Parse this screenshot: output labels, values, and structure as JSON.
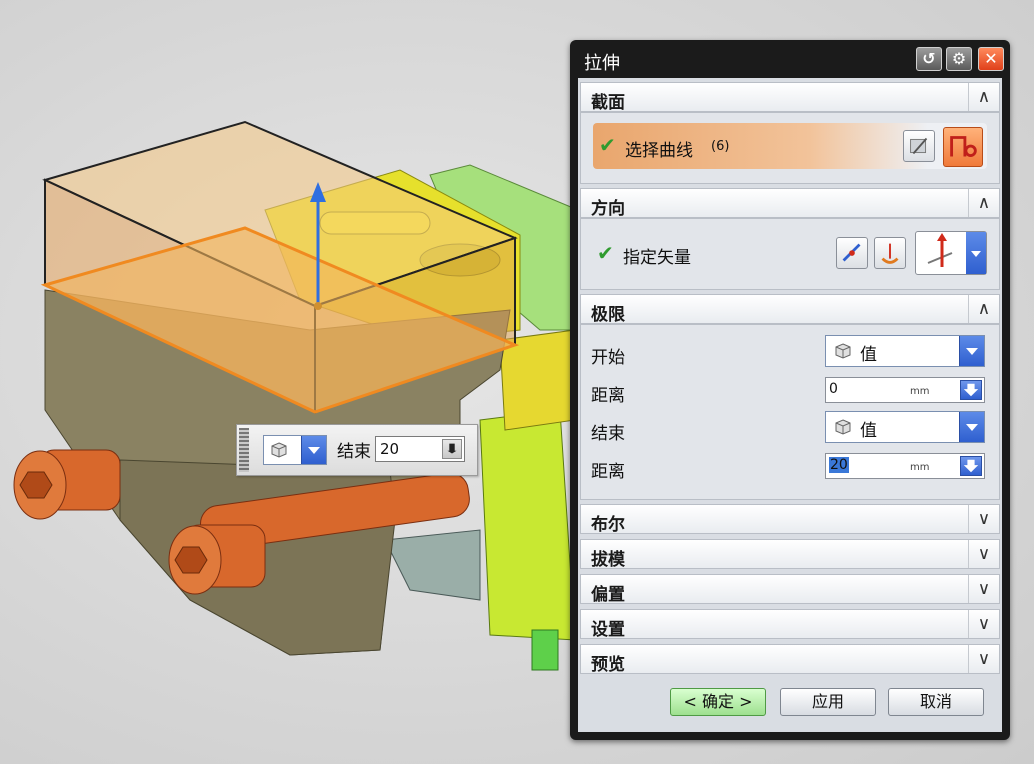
{
  "dialog": {
    "title": "拉伸",
    "titlebar_buttons": {
      "reset": "↺",
      "settings": "⚙",
      "close": "✕"
    },
    "sections": {
      "section": {
        "label": "截面",
        "select_curve": "选择曲线",
        "count": "(6)"
      },
      "direction": {
        "label": "方向",
        "specify_vector": "指定矢量"
      },
      "limits": {
        "label": "极限",
        "start_label": "开始",
        "start_value": "值",
        "start_distance_label": "距离",
        "start_distance": "0",
        "end_label": "结束",
        "end_value": "值",
        "end_distance_label": "距离",
        "end_distance": "20",
        "unit": "mm"
      },
      "boolean": {
        "label": "布尔"
      },
      "draft": {
        "label": "拔模"
      },
      "offset": {
        "label": "偏置"
      },
      "settings": {
        "label": "设置"
      },
      "preview": {
        "label": "预览"
      }
    },
    "buttons": {
      "ok": "< 确定 >",
      "apply": "应用",
      "cancel": "取消"
    }
  },
  "floating_bar": {
    "end_label": "结束",
    "end_value": "20"
  },
  "colors": {
    "accent_blue": "#2f5fcf",
    "selected_orange": "#f07a3a",
    "check_green": "#2f9b2f",
    "extrude_preview": "#f0b060",
    "model_body": "#8a8060",
    "yellow_part": "#e8e030",
    "green_part": "#9ee07a",
    "bolt_orange": "#d8682c"
  }
}
